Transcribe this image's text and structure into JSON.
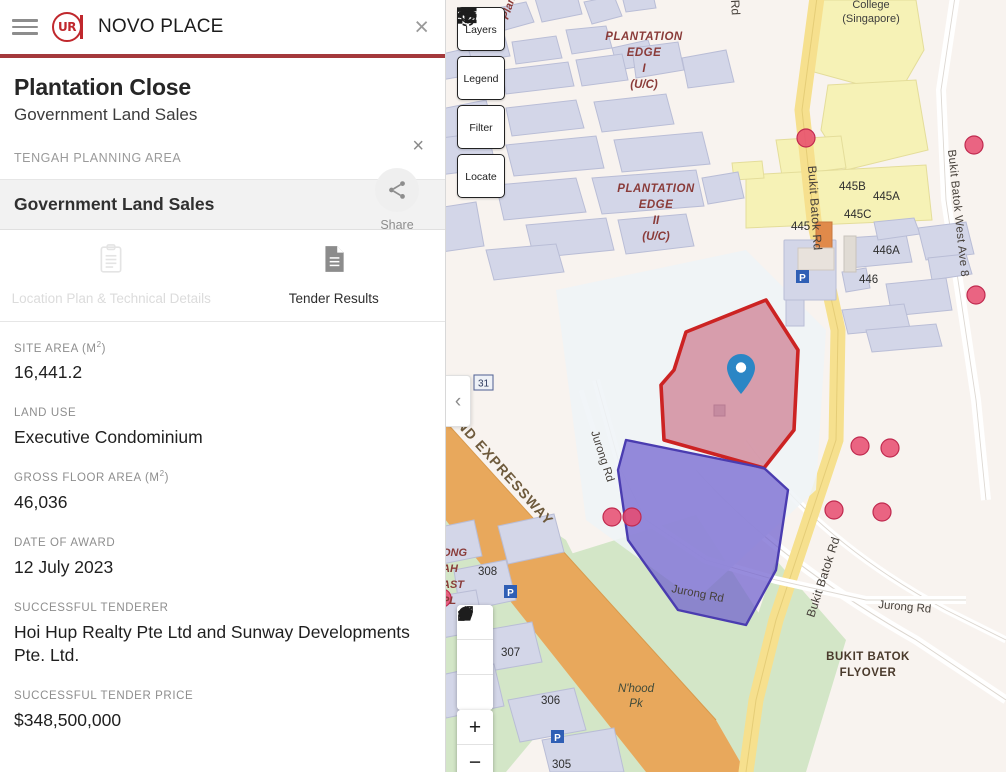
{
  "appbar": {
    "menu_icon": "hamburger-menu-icon",
    "logo_text": "UR",
    "title": "NOVO PLACE",
    "close_label": "×"
  },
  "header": {
    "title": "Plantation Close",
    "subtitle": "Government Land Sales",
    "planning_area": "TENGAH PLANNING AREA",
    "close_label": "×",
    "share_label": "Share",
    "accent_color": "#a4393c"
  },
  "section": {
    "heading": "Government Land Sales"
  },
  "tabs": [
    {
      "label": "Location Plan & Technical Details",
      "icon": "clipboard-icon",
      "state": "disabled"
    },
    {
      "label": "Tender Results",
      "icon": "document-icon",
      "state": "active"
    }
  ],
  "details": [
    {
      "label": "SITE AREA (M",
      "sup": "2",
      "label_end": ")",
      "value": "16,441.2"
    },
    {
      "label": "LAND USE",
      "sup": "",
      "label_end": "",
      "value": "Executive Condominium"
    },
    {
      "label": "GROSS FLOOR AREA (M",
      "sup": "2",
      "label_end": ")",
      "value": "46,036"
    },
    {
      "label": "DATE OF AWARD",
      "sup": "",
      "label_end": "",
      "value": "12 July 2023"
    },
    {
      "label": "SUCCESSFUL TENDERER",
      "sup": "",
      "label_end": "",
      "value": "Hoi Hup Realty Pte Ltd and Sunway Developments Pte. Ltd."
    },
    {
      "label": "SUCCESSFUL TENDER PRICE",
      "sup": "",
      "label_end": "",
      "value": "$348,500,000"
    }
  ],
  "map": {
    "controls": [
      {
        "label": "Layers",
        "icon": "layers-icon"
      },
      {
        "label": "Legend",
        "icon": "legend-list-icon"
      },
      {
        "label": "Filter",
        "icon": "filter-funnel-icon"
      },
      {
        "label": "Locate",
        "icon": "locate-target-icon"
      }
    ],
    "draw_tools": [
      {
        "icon": "measure-line-icon"
      },
      {
        "icon": "polygon-icon"
      },
      {
        "icon": "circle-icon"
      }
    ],
    "zoom_in_label": "+",
    "collapse_label": "‹",
    "colors": {
      "site_fill": "#cf8497",
      "site_stroke": "#cc2323",
      "adjacent_fill": "#6f60cf",
      "adjacent_stroke": "#4a3cb0",
      "pin": "#2b86c5",
      "expressway": "#e8a85c",
      "road": "#f3dd8e",
      "park": "#cbe3c0",
      "building": "#d3d6e8",
      "institution": "#f5f0b4",
      "land": "#f7f2ee"
    },
    "labels": [
      {
        "text": "PLANTATION EDGE I (U/C)",
        "kind": "estate"
      },
      {
        "text": "PLANTATION EDGE II (U/C)",
        "kind": "estate"
      },
      {
        "text": "College (Singapore)",
        "kind": "poi"
      },
      {
        "text": "BUKIT BATOK FLYOVER",
        "kind": "landmark"
      },
      {
        "text": "N'hood Pk",
        "kind": "park"
      },
      {
        "text": "JURONG EAST ST / PL",
        "kind": "estate"
      }
    ],
    "roads": [
      "Bukit Batok Rd",
      "Bukit Batok West Ave 8",
      "Jurong Rd",
      "Jurong Rd",
      "PAN ISLAND EXPRESSWAY",
      "Bukit Batok Rd"
    ],
    "building_numbers": [
      "445",
      "445A",
      "445B",
      "445C",
      "446",
      "446A",
      "305",
      "306",
      "307",
      "308",
      "31"
    ],
    "misc_text": [
      "Whye"
    ]
  }
}
